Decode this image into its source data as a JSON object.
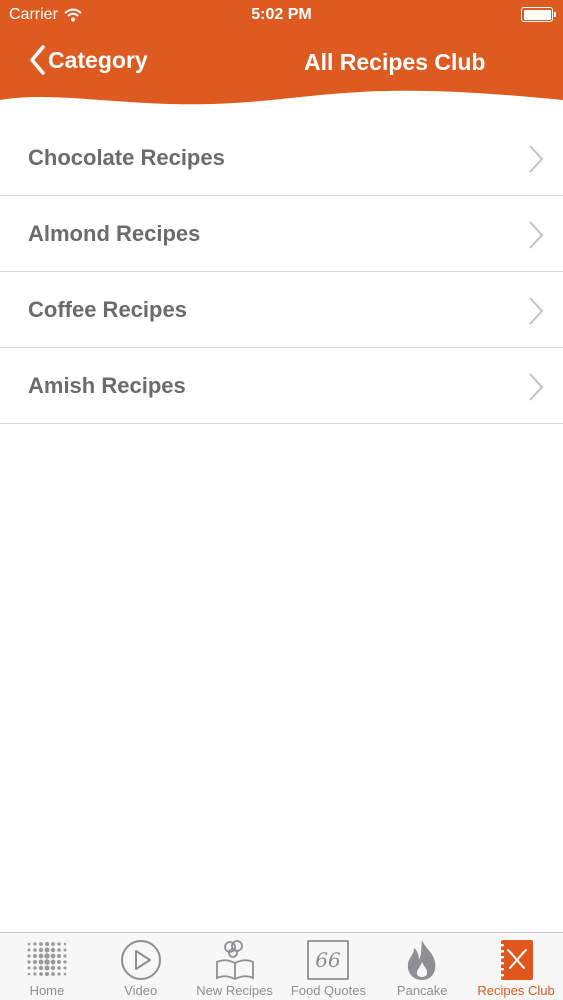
{
  "status_bar": {
    "carrier": "Carrier",
    "time": "5:02 PM",
    "battery_level": 1.0
  },
  "nav": {
    "back_label": "Category",
    "title": "All Recipes Club"
  },
  "colors": {
    "accent": "#dd5b20",
    "list_text": "#6b6b6b",
    "separator": "#d6d6d6",
    "tab_inactive": "#8e8e93",
    "tab_active": "#e0571d"
  },
  "list": {
    "items": [
      {
        "label": "Chocolate Recipes"
      },
      {
        "label": "Almond Recipes"
      },
      {
        "label": "Coffee Recipes"
      },
      {
        "label": "Amish Recipes"
      }
    ]
  },
  "tabbar": {
    "tabs": [
      {
        "label": "Home",
        "icon": "dots-grid-icon",
        "active": false
      },
      {
        "label": "Video",
        "icon": "play-circle-icon",
        "active": false
      },
      {
        "label": "New Recipes",
        "icon": "chef-book-icon",
        "active": false
      },
      {
        "label": "Food Quotes",
        "icon": "quote-box-icon",
        "active": false
      },
      {
        "label": "Pancake",
        "icon": "flame-icon",
        "active": false
      },
      {
        "label": "Recipes Club",
        "icon": "recipe-notebook-icon",
        "active": true
      }
    ]
  }
}
